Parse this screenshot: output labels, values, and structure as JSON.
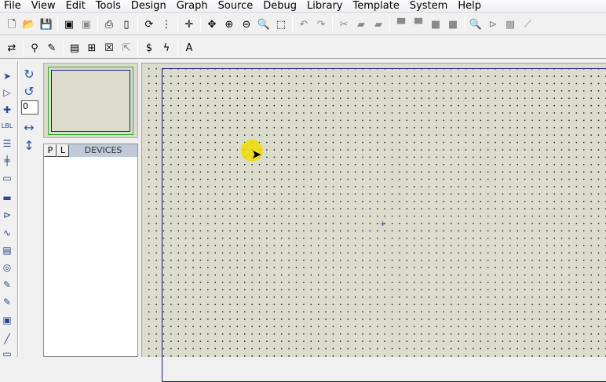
{
  "menu": [
    "File",
    "View",
    "Edit",
    "Tools",
    "Design",
    "Graph",
    "Source",
    "Debug",
    "Library",
    "Template",
    "System",
    "Help"
  ],
  "toolbar1": [
    {
      "name": "new-icon",
      "g": "🗋"
    },
    {
      "name": "open-icon",
      "g": "📂"
    },
    {
      "name": "save-icon",
      "g": "💾"
    },
    {
      "sep": true
    },
    {
      "name": "import-icon",
      "g": "▣"
    },
    {
      "name": "export-icon",
      "g": "▣",
      "grey": true
    },
    {
      "sep": true
    },
    {
      "name": "print-icon",
      "g": "⎙"
    },
    {
      "name": "print-area-icon",
      "g": "▯"
    },
    {
      "sep": true
    },
    {
      "name": "refresh-icon",
      "g": "⟳"
    },
    {
      "name": "grid-icon",
      "g": "⋮"
    },
    {
      "sep": true
    },
    {
      "name": "origin-icon",
      "g": "✛"
    },
    {
      "sep": true
    },
    {
      "name": "pan-icon",
      "g": "✥"
    },
    {
      "name": "zoom-in-icon",
      "g": "⊕"
    },
    {
      "name": "zoom-out-icon",
      "g": "⊖"
    },
    {
      "name": "zoom-all-icon",
      "g": "🔍"
    },
    {
      "name": "zoom-area-icon",
      "g": "⬚"
    },
    {
      "sep": true
    },
    {
      "name": "undo-icon",
      "g": "↶",
      "grey": true
    },
    {
      "name": "redo-icon",
      "g": "↷",
      "grey": true
    },
    {
      "sep": true
    },
    {
      "name": "cut-icon",
      "g": "✂",
      "grey": true
    },
    {
      "name": "copy-icon",
      "g": "▰",
      "grey": true
    },
    {
      "name": "paste-icon",
      "g": "▰",
      "grey": true
    },
    {
      "sep": true
    },
    {
      "name": "block-copy-icon",
      "g": "▀",
      "grey": true
    },
    {
      "name": "block-move-icon",
      "g": "▀",
      "grey": true
    },
    {
      "name": "block-rotate-icon",
      "g": "■",
      "grey": true
    },
    {
      "name": "block-delete-icon",
      "g": "■",
      "grey": true
    },
    {
      "sep": true
    },
    {
      "name": "pick-device-icon",
      "g": "🔍"
    },
    {
      "name": "make-device-icon",
      "g": "⊳",
      "grey": true
    },
    {
      "name": "package-tool-icon",
      "g": "▩",
      "grey": true
    },
    {
      "name": "decompose-icon",
      "g": "⟋",
      "grey": true
    }
  ],
  "toolbar2": [
    {
      "name": "wire-autorouter-icon",
      "g": "⇄"
    },
    {
      "sep": true
    },
    {
      "name": "search-tag-icon",
      "g": "⚲"
    },
    {
      "name": "property-tool-icon",
      "g": "✎"
    },
    {
      "sep": true
    },
    {
      "name": "new-sheet-icon",
      "g": "▤"
    },
    {
      "name": "add-sheet-icon",
      "g": "⊞"
    },
    {
      "name": "remove-sheet-icon",
      "g": "☒"
    },
    {
      "name": "goto-parent-icon",
      "g": "⇱",
      "grey": true
    },
    {
      "sep": true
    },
    {
      "name": "bill-of-materials-icon",
      "g": "$"
    },
    {
      "name": "electrical-check-icon",
      "g": "ϟ"
    },
    {
      "sep": true
    },
    {
      "name": "ares-icon",
      "g": "A"
    }
  ],
  "lefttools": [
    {
      "name": "selection-mode-icon",
      "g": "➤"
    },
    {
      "name": "component-mode-icon",
      "g": "▷"
    },
    {
      "name": "junction-dot-icon",
      "g": "✚"
    },
    {
      "name": "wire-label-icon",
      "g": "LBL"
    },
    {
      "name": "text-script-icon",
      "g": "☰"
    },
    {
      "name": "buses-icon",
      "g": "╪"
    },
    {
      "name": "subcircuit-icon",
      "g": "▭"
    },
    {
      "name": "terminals-icon",
      "g": "▬"
    },
    {
      "name": "device-pins-icon",
      "g": "⊳"
    },
    {
      "name": "graph-icon",
      "g": "∿"
    },
    {
      "name": "tape-recorder-icon",
      "g": "▤"
    },
    {
      "name": "generator-icon",
      "g": "◎"
    },
    {
      "name": "voltage-probe-icon",
      "g": "✎"
    },
    {
      "name": "current-probe-icon",
      "g": "✎"
    },
    {
      "name": "virtual-instruments-icon",
      "g": "▣"
    },
    {
      "name": "line-icon",
      "g": "╱"
    },
    {
      "name": "box-icon",
      "g": "▭"
    }
  ],
  "orientation": {
    "rotate_cw": "↻",
    "rotate_ccw": "↺",
    "angle": "0",
    "mirror_x": "↔",
    "mirror_y": "↕"
  },
  "devices": {
    "pick_label": "P",
    "library_label": "L",
    "title": "DEVICES"
  },
  "colors": {
    "canvas": "#dcdccc",
    "sheet_border": "#1a1a80",
    "overview_border": "#30b030",
    "cursor_highlight": "#f0dc00"
  }
}
